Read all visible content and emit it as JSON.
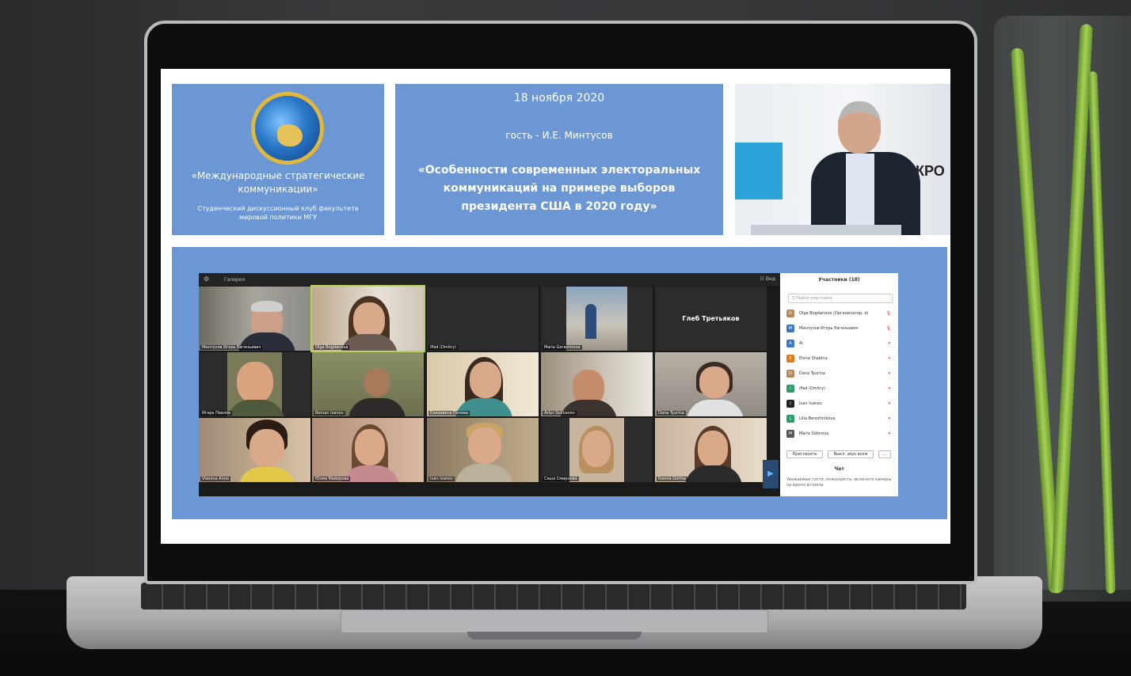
{
  "slide": {
    "org_name": "«Международные стратегические коммуникации»",
    "org_sub": "Студенческий дискуссионный клуб факультета мировой политики МГУ",
    "date": "18 ноября 2020",
    "guest": "гость - И.Е. Минтусов",
    "talk_title": "«Особенности современных электоральных коммуникаций на примере выборов президента США в 2020 году»",
    "photo_banner": "КРО"
  },
  "zoom": {
    "toolbar_label": "Галерея",
    "grid_button": "☷ Вид",
    "tiles": [
      {
        "name": "Минтусов Игорь Евгеньевич",
        "big": ""
      },
      {
        "name": "Olga Bogdanova",
        "big": ""
      },
      {
        "name": "iPad (Dmitry)",
        "big": ""
      },
      {
        "name": "Maria Gerasimova",
        "big": ""
      },
      {
        "name": "",
        "big": "Глеб Третьяков"
      },
      {
        "name": "Игорь Павлов",
        "big": ""
      },
      {
        "name": "Roman Ivanov",
        "big": ""
      },
      {
        "name": "Елизавета Попова",
        "big": ""
      },
      {
        "name": "Artur Sukhanov",
        "big": ""
      },
      {
        "name": "Dana Tyurina",
        "big": ""
      },
      {
        "name": "Vlasova Anna",
        "big": ""
      },
      {
        "name": "Юлия Майорова",
        "big": ""
      },
      {
        "name": "Ivan Ivanov",
        "big": ""
      },
      {
        "name": "Саша Смирнова",
        "big": ""
      },
      {
        "name": "Ksenia Gorina",
        "big": ""
      }
    ],
    "participants": {
      "title": "Участники (18)",
      "search_placeholder": "Q Найти участника",
      "rows": [
        {
          "name": "Olga Bogdanova (Организатор, я)",
          "initial": "O",
          "color": "#b88a5a"
        },
        {
          "name": "Минтусов Игорь Евгеньевич",
          "initial": "M",
          "color": "#3a78c2"
        },
        {
          "name": "Al",
          "initial": "A",
          "color": "#3a78c2"
        },
        {
          "name": "Elena Shabina",
          "initial": "E",
          "color": "#e07a1f"
        },
        {
          "name": "Dana Tyurina",
          "initial": "D",
          "color": "#b88a5a"
        },
        {
          "name": "iPad (Dmitry)",
          "initial": "i",
          "color": "#2e9a6a"
        },
        {
          "name": "Ivan Ivanov",
          "initial": "I",
          "color": "#222222"
        },
        {
          "name": "Lilia Berezhnikova",
          "initial": "L",
          "color": "#2e9a6a"
        },
        {
          "name": "Maria Sidorova",
          "initial": "M",
          "color": "#555555"
        }
      ],
      "invite_button": "Пригласить",
      "mute_all_button": "Выкл. звук всем",
      "more_button": "...",
      "chat_title": "Чат",
      "chat_message": "Уважаемые гости, пожалуйста, включите камеры на время встречи"
    }
  }
}
